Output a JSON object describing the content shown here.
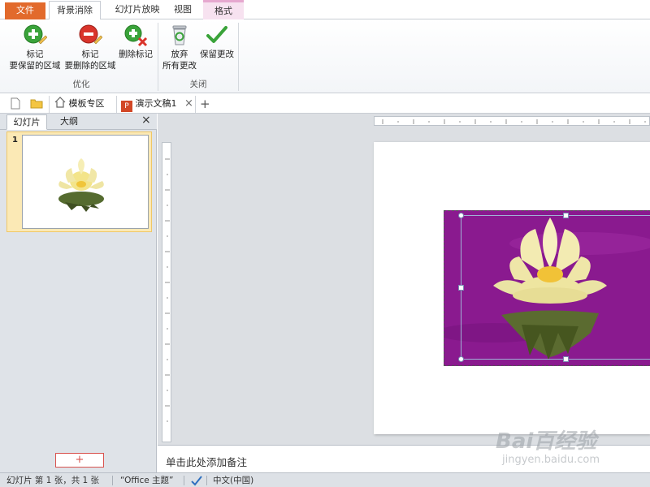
{
  "ribbon": {
    "tabs": {
      "file": "文件",
      "bg_remove": "背景消除",
      "slideshow": "幻灯片放映",
      "view": "视图",
      "format": "格式"
    },
    "buttons": {
      "mark_keep_l1": "标记",
      "mark_keep_l2": "要保留的区域",
      "mark_remove_l1": "标记",
      "mark_remove_l2": "要删除的区域",
      "delete_mark": "删除标记",
      "discard_l1": "放弃",
      "discard_l2": "所有更改",
      "keep_changes": "保留更改"
    },
    "groups": {
      "optimize": "优化",
      "close": "关闭"
    }
  },
  "doc_tabs": {
    "template": "模板专区",
    "document": "演示文稿1"
  },
  "left_panel": {
    "tab_slides": "幻灯片",
    "tab_outline": "大纲",
    "slide_number": "1",
    "add_slide": "+"
  },
  "notes_placeholder": "单击此处添加备注",
  "status": {
    "slide_info": "幻灯片 第 1 张，共 1 张",
    "theme": "“Office 主题”",
    "language": "中文(中国)"
  },
  "watermark": {
    "brand": "Bai百经验",
    "url": "jingyen.baidu.com"
  },
  "colors": {
    "file_tab": "#e26a2c",
    "format_tab": "#f7e2f0",
    "picture_bg": "#8a1a8f",
    "keep_green": "#3aa33a",
    "remove_red": "#d9342b"
  }
}
